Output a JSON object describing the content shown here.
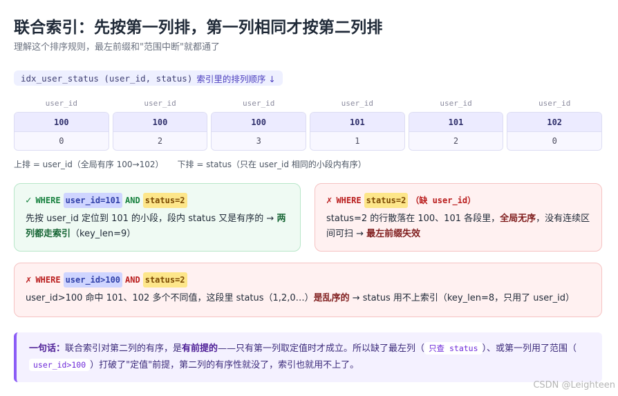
{
  "header": {
    "title": "联合索引：先按第一列排，第一列相同才按第二列排",
    "subtitle": "理解这个排序规则，最左前缀和\"范围中断\"就都通了"
  },
  "index": {
    "code": "idx_user_status (user_id, status)",
    "label": "索引里的排列顺序 ↓"
  },
  "columns": [
    {
      "head": "user_id",
      "user_id": "100",
      "status": "0"
    },
    {
      "head": "user_id",
      "user_id": "100",
      "status": "2"
    },
    {
      "head": "user_id",
      "user_id": "100",
      "status": "3"
    },
    {
      "head": "user_id",
      "user_id": "101",
      "status": "1"
    },
    {
      "head": "user_id",
      "user_id": "101",
      "status": "2"
    },
    {
      "head": "user_id",
      "user_id": "102",
      "status": "0"
    }
  ],
  "legend": {
    "top": "上排 = user_id（全局有序 100→102）",
    "bottom": "下排 = status（只在 user_id 相同的小段内有序）"
  },
  "cards": {
    "good": {
      "mark": "✓",
      "where": "WHERE",
      "cond1": "user_id=101",
      "and": "AND",
      "cond2": "status=2",
      "body_pre": "先按 user_id 定位到 101 的小段，段内 status 又是有序的 → ",
      "body_bold": "两列都走索引",
      "body_post": "（key_len=9）"
    },
    "bad1": {
      "mark": "✗",
      "where": "WHERE",
      "cond": "status=2",
      "missing": "（缺 user_id）",
      "body_pre": "status=2 的行散落在 100、101 各段里，",
      "body_bold1": "全局无序",
      "body_mid": "，没有连续区间可扫 → ",
      "body_bold2": "最左前缀失效"
    },
    "bad2": {
      "mark": "✗",
      "where": "WHERE",
      "cond1": "user_id>100",
      "and": "AND",
      "cond2": "status=2",
      "body_pre": "user_id>100 命中 101、102 多个不同值，这段里 status（1,2,0…）",
      "body_bold": "是乱序的",
      "body_post": " → status 用不上索引（key_len=8，只用了 user_id）"
    }
  },
  "summary": {
    "lead": "一句话：",
    "t1": "联合索引对第二列的有序，是",
    "b1": "有前提的",
    "t2": "——只有第一列取定值时才成立。所以缺了最左列（",
    "code1": "只查 status",
    "t3": "）、或第一列用了范围（",
    "code2": "user_id>100",
    "t4": "）打破了\"定值\"前提，第二列的有序性就没了，索引也就用不上了。"
  },
  "watermark": "CSDN @Leighteen",
  "colors": {
    "accent_purple": "#8b5cf6",
    "good_green": "#15803d",
    "bad_red": "#b91c1c",
    "highlight_yellow": "#fde68a",
    "highlight_blue": "#cfd5ff"
  }
}
